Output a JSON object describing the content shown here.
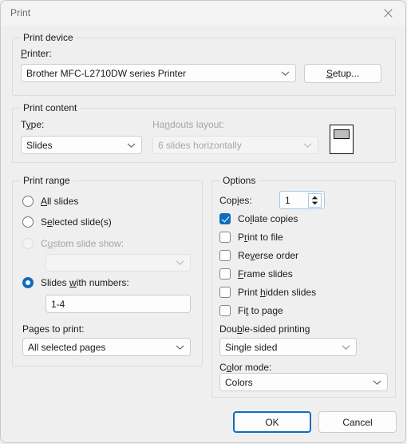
{
  "window": {
    "title": "Print",
    "close_icon": "close-icon"
  },
  "print_device": {
    "group_label": "Print device",
    "printer_label": "Printer:",
    "printer_value": "Brother MFC-L2710DW series Printer",
    "setup_button": "Setup..."
  },
  "print_content": {
    "group_label": "Print content",
    "type_label": "Type:",
    "type_value": "Slides",
    "handouts_label": "Handouts layout:",
    "handouts_value": "6 slides horizontally",
    "handouts_enabled": false
  },
  "print_range": {
    "group_label": "Print range",
    "options": [
      {
        "label": "All slides",
        "accel": "A",
        "selected": false,
        "enabled": true
      },
      {
        "label": "Selected slide(s)",
        "accel": "e",
        "selected": false,
        "enabled": true
      },
      {
        "label": "Custom slide show:",
        "accel": "u",
        "selected": false,
        "enabled": false
      },
      {
        "label": "Slides with numbers:",
        "accel": "w",
        "selected": true,
        "enabled": true
      }
    ],
    "custom_show_value": "",
    "slides_numbers_value": "1-4",
    "pages_to_print_label": "Pages to print:",
    "pages_to_print_value": "All selected pages"
  },
  "options": {
    "group_label": "Options",
    "copies_label": "Copies:",
    "copies_value": "1",
    "checkboxes": [
      {
        "label": "Collate copies",
        "checked": true
      },
      {
        "label": "Print to file",
        "checked": false
      },
      {
        "label": "Reverse order",
        "checked": false
      },
      {
        "label": "Frame slides",
        "checked": false
      },
      {
        "label": "Print hidden slides",
        "checked": false
      },
      {
        "label": "Fit to page",
        "checked": false
      }
    ],
    "double_sided_label": "Double-sided printing",
    "double_sided_value": "Single sided",
    "color_mode_label": "Color mode:",
    "color_mode_value": "Colors"
  },
  "footer": {
    "ok_button": "OK",
    "cancel_button": "Cancel"
  },
  "colors": {
    "accent": "#0f6cbd",
    "dialog_bg": "#efefef",
    "titlebar_bg": "#f3f3f3",
    "field_bg": "#fdfdfd",
    "disabled_text": "#a6a6a6"
  }
}
